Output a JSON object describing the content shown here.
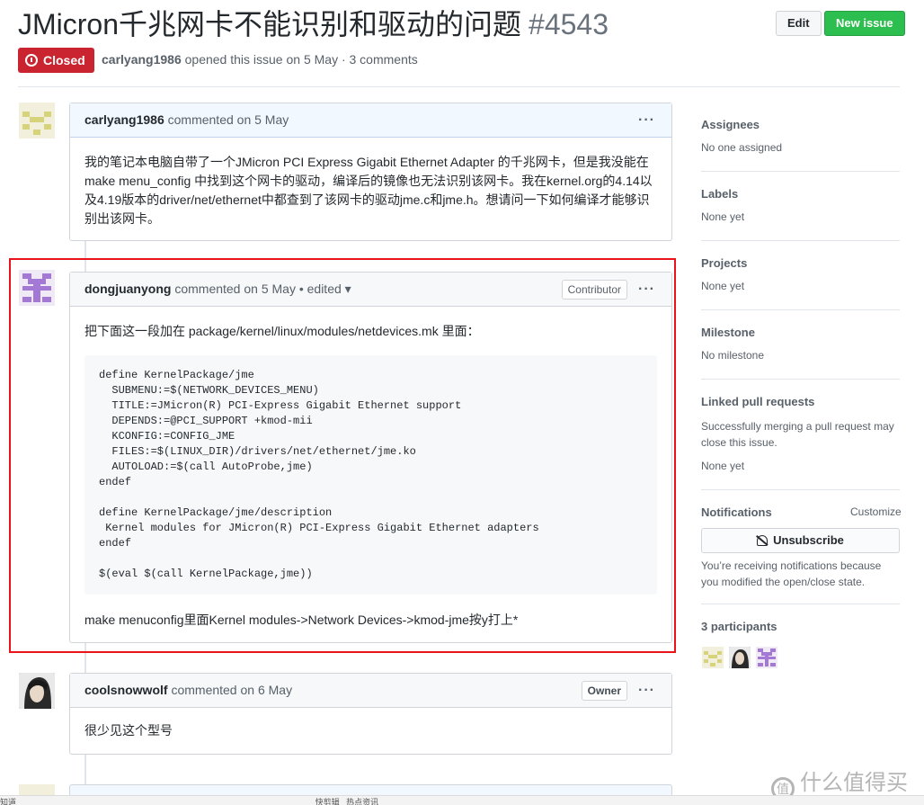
{
  "issue": {
    "title": "JMicron千兆网卡不能识别和驱动的问题",
    "number": "#4543",
    "state": "Closed",
    "author": "carlyang1986",
    "meta_rest": "opened this issue on 5 May · 3 comments"
  },
  "header": {
    "edit_label": "Edit",
    "new_issue_label": "New issue"
  },
  "comments": [
    {
      "author": "carlyang1986",
      "meta": "commented on 5 May",
      "body": "我的笔记本电脑自带了一个JMicron PCI Express Gigabit Ethernet Adapter 的千兆网卡，但是我没能在make menu_config 中找到这个网卡的驱动，编译后的镜像也无法识别该网卡。我在kernel.org的4.14以及4.19版本的driver/net/ethernet中都查到了该网卡的驱动jme.c和jme.h。想请问一下如何编译才能够识别出该网卡。",
      "menu": "···"
    },
    {
      "author": "dongjuanyong",
      "meta": "commented on 5 May • edited ▾",
      "role": "Contributor",
      "intro": "把下面这一段加在 package/kernel/linux/modules/netdevices.mk 里面：",
      "code": "define KernelPackage/jme\n  SUBMENU:=$(NETWORK_DEVICES_MENU)\n  TITLE:=JMicron(R) PCI-Express Gigabit Ethernet support\n  DEPENDS:=@PCI_SUPPORT +kmod-mii\n  KCONFIG:=CONFIG_JME\n  FILES:=$(LINUX_DIR)/drivers/net/ethernet/jme.ko\n  AUTOLOAD:=$(call AutoProbe,jme)\nendef\n\ndefine KernelPackage/jme/description\n Kernel modules for JMicron(R) PCI-Express Gigabit Ethernet adapters\nendef\n\n$(eval $(call KernelPackage,jme))",
      "outro": "make menuconfig里面Kernel modules->Network Devices->kmod-jme按y打上*",
      "menu": "···"
    },
    {
      "author": "coolsnowwolf",
      "meta": "commented on 6 May",
      "role": "Owner",
      "body": "很少见这个型号",
      "menu": "···"
    }
  ],
  "sidebar": {
    "assignees": {
      "label": "Assignees",
      "value": "No one assigned"
    },
    "labels": {
      "label": "Labels",
      "value": "None yet"
    },
    "projects": {
      "label": "Projects",
      "value": "None yet"
    },
    "milestone": {
      "label": "Milestone",
      "value": "No milestone"
    },
    "linked": {
      "label": "Linked pull requests",
      "desc": "Successfully merging a pull request may close this issue.",
      "value": "None yet"
    },
    "notifications": {
      "label": "Notifications",
      "customize": "Customize",
      "button": "Unsubscribe",
      "reason": "You’re receiving notifications because you modified the open/close state."
    },
    "participants": {
      "label": "3 participants"
    }
  },
  "watermark": {
    "text": "什么值得买",
    "logo": "值"
  },
  "bottombar": {
    "text": "知道                                                                                                                                     快剪辑   热点资讯"
  },
  "colors": {
    "closed": "#cb2431",
    "new_issue": "#2cbe4e",
    "highlight": "#e8141a"
  }
}
